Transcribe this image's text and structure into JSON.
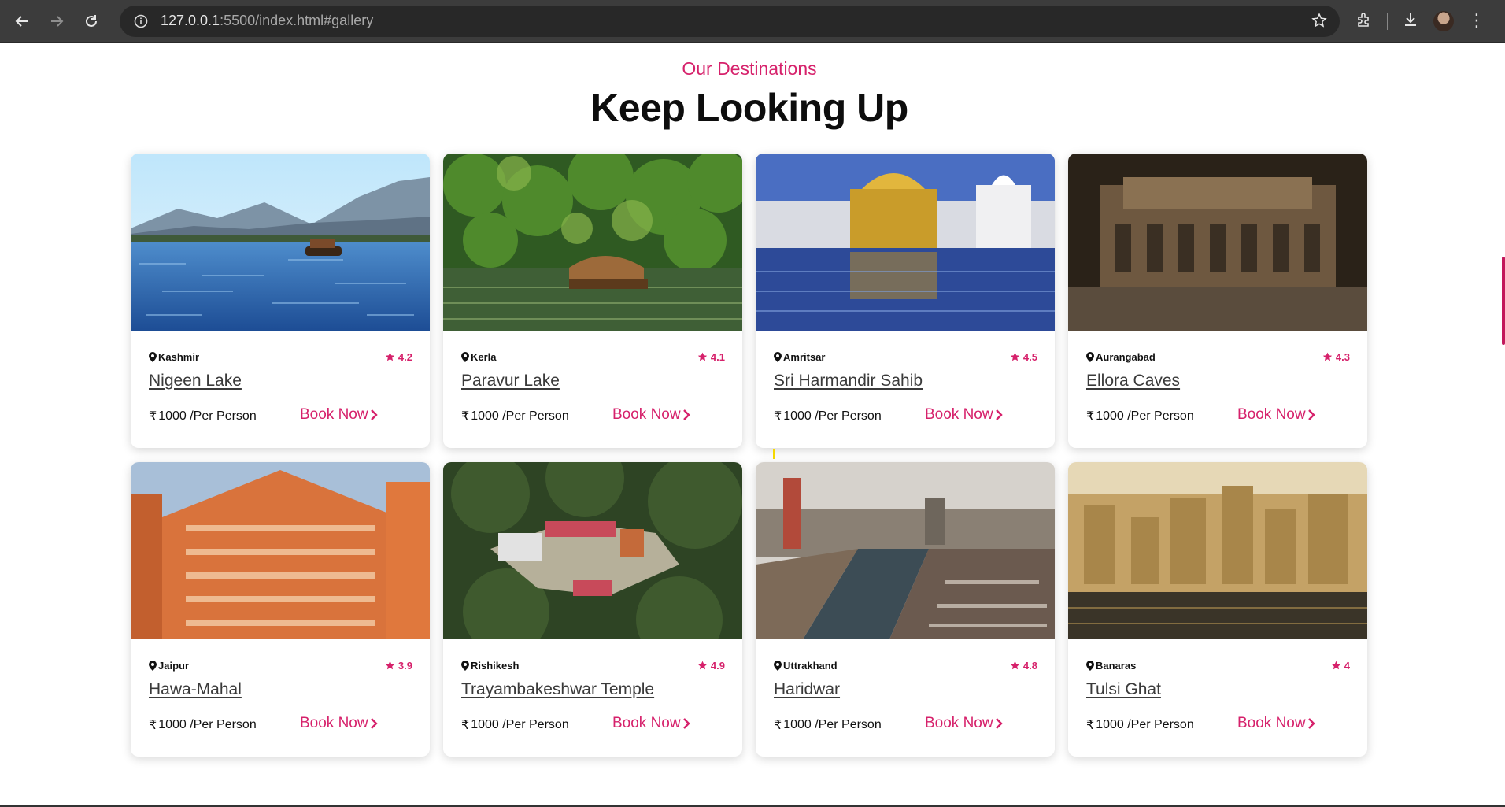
{
  "browser": {
    "url_host": "127.0.0.1",
    "url_rest": ":5500/index.html#gallery"
  },
  "section": {
    "subtitle": "Our Destinations",
    "heading": "Keep Looking Up"
  },
  "colors": {
    "accent": "#d6216b"
  },
  "cards": [
    {
      "location": "Kashmir",
      "rating": "4.2",
      "title": "Nigeen Lake",
      "currency": "₹",
      "price": "1000 /Per Person",
      "cta": "Book Now"
    },
    {
      "location": "Kerla",
      "rating": "4.1",
      "title": "Paravur Lake",
      "currency": "₹",
      "price": "1000 /Per Person",
      "cta": "Book Now"
    },
    {
      "location": "Amritsar",
      "rating": "4.5",
      "title": "Sri Harmandir Sahib",
      "currency": "₹",
      "price": "1000 /Per Person",
      "cta": "Book Now"
    },
    {
      "location": "Aurangabad",
      "rating": "4.3",
      "title": "Ellora Caves",
      "currency": "₹",
      "price": "1000 /Per Person",
      "cta": "Book Now"
    },
    {
      "location": "Jaipur",
      "rating": "3.9",
      "title": "Hawa-Mahal",
      "currency": "₹",
      "price": "1000 /Per Person",
      "cta": "Book Now"
    },
    {
      "location": "Rishikesh",
      "rating": "4.9",
      "title": "Trayambakeshwar Temple",
      "currency": "₹",
      "price": "1000 /Per Person",
      "cta": "Book Now"
    },
    {
      "location": "Uttrakhand",
      "rating": "4.8",
      "title": "Haridwar",
      "currency": "₹",
      "price": "1000 /Per Person",
      "cta": "Book Now"
    },
    {
      "location": "Banaras",
      "rating": "4",
      "title": "Tulsi Ghat",
      "currency": "₹",
      "price": "1000 /Per Person",
      "cta": "Book Now"
    }
  ]
}
